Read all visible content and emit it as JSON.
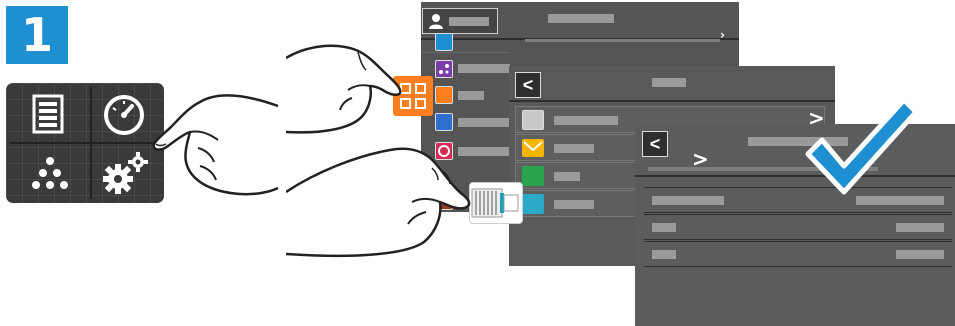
{
  "step": {
    "number": "1"
  },
  "colors": {
    "step_badge": "#1e8fd1",
    "apps_button": "#ff7f20",
    "checkmark": "#1e8fd1",
    "screen_background": "#555555",
    "panel_background": "#3a3a3a"
  },
  "panel_icons": [
    "job-list-icon",
    "dashboard-gauge-icon",
    "network-dots-icon",
    "device-settings-gears-icon"
  ],
  "screen_1": {
    "icons": [
      "user-icon",
      "scan-to-icon",
      "workflow-icon",
      "apps-icon",
      "connect-icon",
      "printer-icon",
      "usb-icon"
    ],
    "icon_colors": [
      "#1e8fd1",
      "#7a3ea8",
      "#ff7f20",
      "#2d6ecf",
      "#d22b55",
      "#9a3c2a"
    ]
  },
  "screen_2": {
    "back_glyph": "<",
    "list_icons": [
      "contacts-icon",
      "email-icon",
      "fax-icon",
      "card-icon"
    ],
    "list_icon_colors": [
      "#c8c8c8",
      "#f5b400",
      "#29a54f",
      "#2aa9c9"
    ],
    "chevron_glyph": ">"
  },
  "screen_3": {
    "back_glyph": "<",
    "chevron_glyph": ">",
    "checkmark_icon": "checkmark-icon"
  },
  "gesture_icons": [
    "hand-pointing-top-icon",
    "hand-pointing-middle-icon",
    "hand-pointing-bottom-icon"
  ],
  "usb_drive_icon": "usb-drive-icon"
}
